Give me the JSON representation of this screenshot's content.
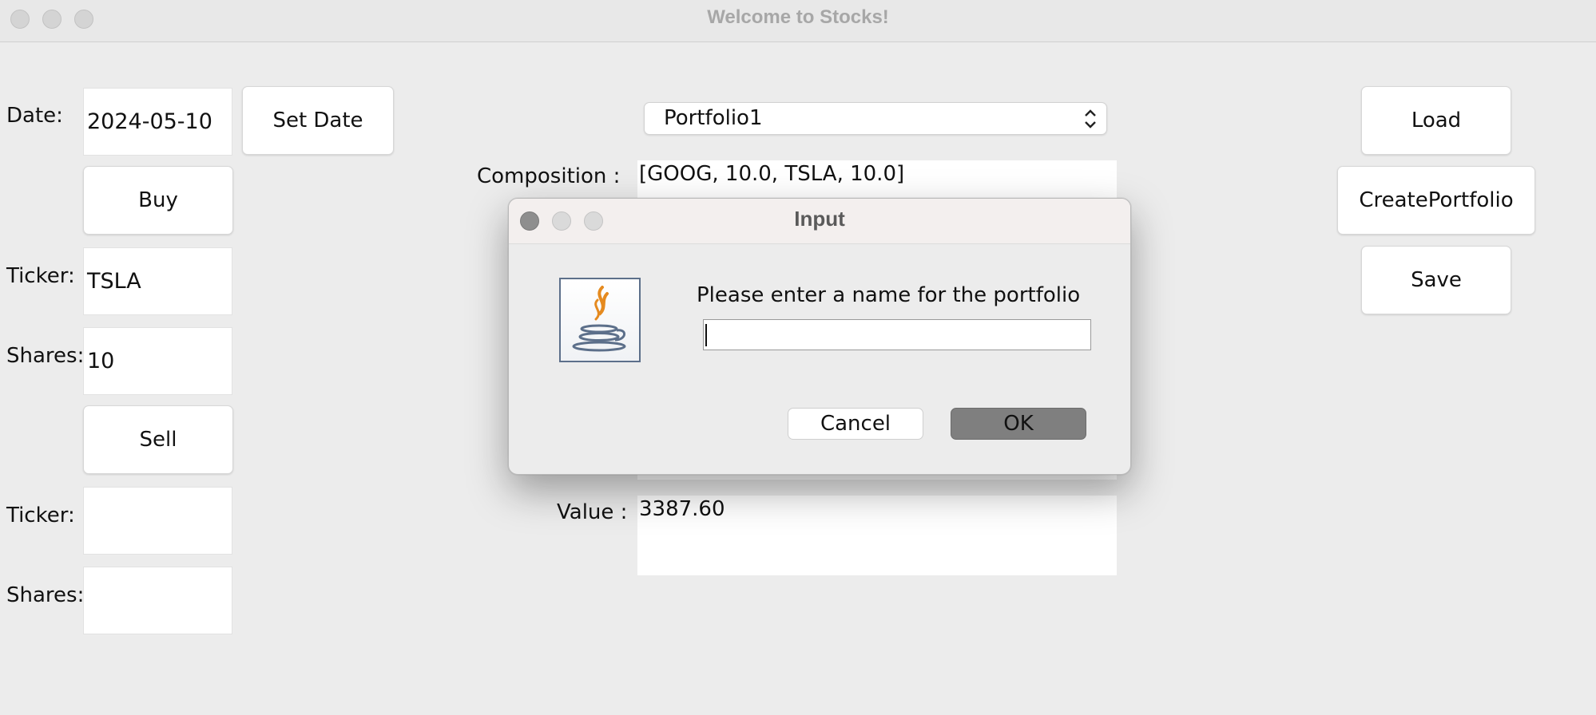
{
  "window": {
    "title": "Welcome to Stocks!"
  },
  "left_panel": {
    "date_label": "Date:",
    "date_value": "2024-05-10",
    "set_date_label": "Set Date",
    "buy_label": "Buy",
    "buy_ticker_label": "Ticker:",
    "buy_ticker_value": "TSLA",
    "buy_shares_label": "Shares:",
    "buy_shares_value": "10",
    "sell_label": "Sell",
    "sell_ticker_label": "Ticker:",
    "sell_ticker_value": "",
    "sell_shares_label": "Shares:",
    "sell_shares_value": ""
  },
  "center_panel": {
    "portfolio_selected": "Portfolio1",
    "composition_label": "Composition :",
    "composition_value": "[GOOG, 10.0, TSLA, 10.0]",
    "value_label": "Value :",
    "value_value": "3387.60"
  },
  "right_panel": {
    "load_label": "Load",
    "create_label": "CreatePortfolio",
    "save_label": "Save"
  },
  "dialog": {
    "title": "Input",
    "message": "Please enter a name for the portfolio",
    "input_value": "",
    "cancel_label": "Cancel",
    "ok_label": "OK"
  },
  "colors": {
    "window_bg": "#ececec",
    "ok_button_bg": "#7f7f7f",
    "java_cup_orange": "#e58a1f",
    "java_blue": "#5c6f8a"
  },
  "icons": {
    "dialog_icon": "java-icon",
    "combo_arrow": "chevron-updown-icon"
  }
}
